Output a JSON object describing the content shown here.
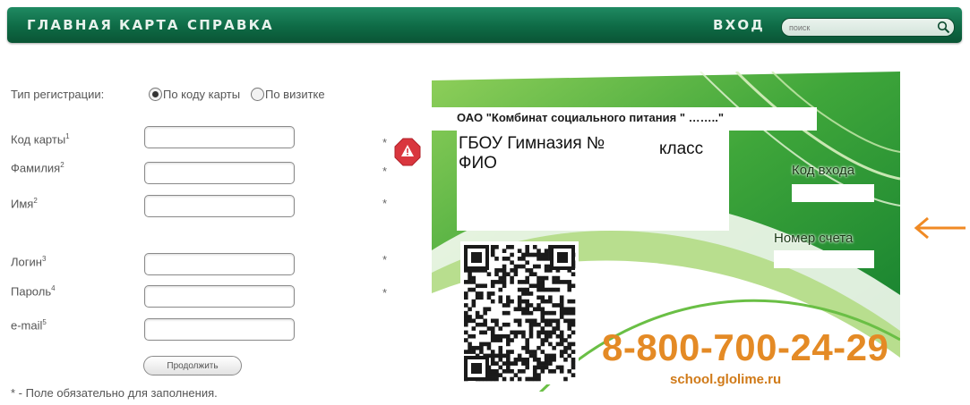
{
  "nav": {
    "items": [
      {
        "label": "ГЛАВНАЯ"
      },
      {
        "label": "КАРТА"
      },
      {
        "label": "СПРАВКА"
      }
    ],
    "login": "ВХОД",
    "search_placeholder": "поиск"
  },
  "form": {
    "reg_type_label": "Тип регистрации:",
    "reg_options": [
      {
        "label": "По коду карты",
        "checked": true
      },
      {
        "label": "По визитке",
        "checked": false
      }
    ],
    "fields": [
      {
        "label": "Код карты",
        "sup": "1",
        "required": true
      },
      {
        "label": "Фамилия",
        "sup": "2",
        "required": true
      },
      {
        "label": "Имя",
        "sup": "2",
        "required": true
      },
      {
        "label": "Логин",
        "sup": "3",
        "required": true
      },
      {
        "label": "Пароль",
        "sup": "4",
        "required": true
      },
      {
        "label": "e-mail",
        "sup": "5",
        "required": false
      }
    ],
    "required_mark": "*",
    "continue_button": "Продолжить",
    "footnote": "* - Поле обязательно для заполнения."
  },
  "card": {
    "title": "ОАО \"Комбинат социального питания \" ……..\"",
    "school": "ГБОУ Гимназия №",
    "class_label": "класс",
    "fio": "ФИО",
    "login_code_label": "Код входа",
    "account_number_label": "Номер счета",
    "phone": "8-800-700-24-29",
    "website": "school.glolime.ru"
  },
  "colors": {
    "nav_green": "#0e6a45",
    "card_green": "#2f9a2f",
    "phone_orange": "#e48a25",
    "arrow_orange": "#f08a24",
    "warning_red": "#d9363e"
  }
}
